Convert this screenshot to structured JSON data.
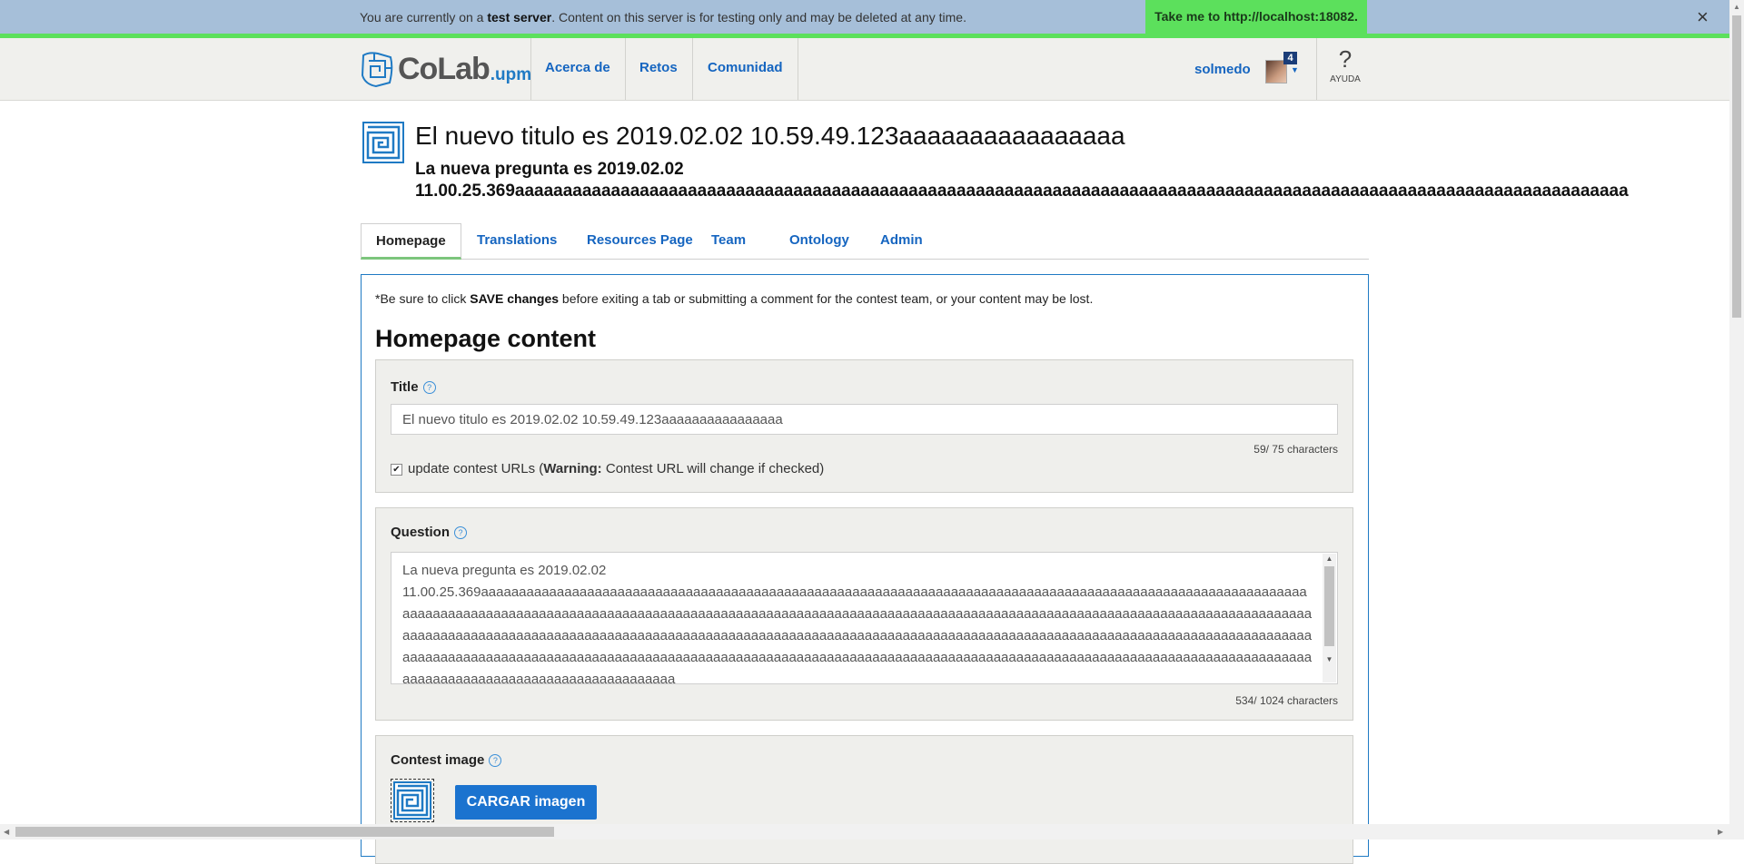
{
  "banner": {
    "text_before": "You are currently on a ",
    "text_bold": "test server",
    "text_after": ". Content on this server is for testing only and may be deleted at any time.",
    "button_label": "Take me to http://localhost:18082.",
    "close_symbol": "×"
  },
  "header": {
    "logo_word": "CoLab",
    "logo_suffix": ".upm",
    "nav": [
      "Acerca de",
      "Retos",
      "Comunidad"
    ],
    "username": "solmedo",
    "notification_count": "4",
    "help_symbol": "?",
    "help_label": "AYUDA"
  },
  "contest": {
    "title": "El nuevo titulo es 2019.02.02 10.59.49.123aaaaaaaaaaaaaaaa",
    "question_line1": "La nueva pregunta es 2019.02.02",
    "question_line2": "11.00.25.369aaaaaaaaaaaaaaaaaaaaaaaaaaaaaaaaaaaaaaaaaaaaaaaaaaaaaaaaaaaaaaaaaaaaaaaaaaaaaaaaaaaaaaaaaaaaaaaaaaaaaaaaaaaaaaaaaaaa"
  },
  "tabs": [
    "Homepage",
    "Translations",
    "Resources Page",
    "Team",
    "Ontology",
    "Admin"
  ],
  "editor": {
    "note_before": "*Be sure to click ",
    "note_bold": "SAVE changes",
    "note_after": " before exiting a tab or submitting a comment for the contest team, or your content may be lost.",
    "heading": "Homepage content",
    "title_label": "Title",
    "title_value": "El nuevo titulo es 2019.02.02 10.59.49.123aaaaaaaaaaaaaaaa",
    "title_counter": "59/ 75 characters",
    "update_urls_before": "update contest URLs (",
    "update_urls_bold": "Warning:",
    "update_urls_after": " Contest URL will change if checked)",
    "update_urls_checked": true,
    "question_label": "Question",
    "question_value": "La nueva pregunta es 2019.02.02\n11.00.25.369aaaaaaaaaaaaaaaaaaaaaaaaaaaaaaaaaaaaaaaaaaaaaaaaaaaaaaaaaaaaaaaaaaaaaaaaaaaaaaaaaaaaaaaaaaaaaaaaaaaaaaaaaaaaaaaaaaaaaaaaaaaaaaaaaaaaaaaaaaaaaaaaaaaaaaaaaaaaaaaaaaaaaaaaaaaaaaaaaaaaaaaaaaaaaaaaaaaaaaaaaaaaaaaaaaaaaaaaaaaaaaaaaaaaaaaaaaaaaaaaaaaaaaaaaaaaaaaaaaaaaaaaaaaaaaaaaaaaaaaaaaaaaaaaaaaaaaaaaaaaaaaaaaaaaaaaaaaaaaaaaaaaaaaaaaaaaaaaaaaaaaaaaaaaaaaaaaaaaaaaaaaaaaaaaaaaaaaaaaaaaaaaaaaaaaaaaaaaaaaaaaaaaaaaaaaaaaaaaaaaaaaaaaaaaaaaaaaaaaaaaaaaaaaaaaaaaaaaaaaaaaaaaaaaaaaaaaaaaaaaaaaaaaaaaaaaaaaaaaaaaaaaa",
    "question_counter": "534/ 1024 characters",
    "image_label": "Contest image",
    "upload_label": "CARGAR imagen"
  },
  "colors": {
    "banner_bg": "#a6bfd9",
    "banner_green": "#5ce05c",
    "link_blue": "#1565c0",
    "primary_button": "#1b73cf"
  }
}
